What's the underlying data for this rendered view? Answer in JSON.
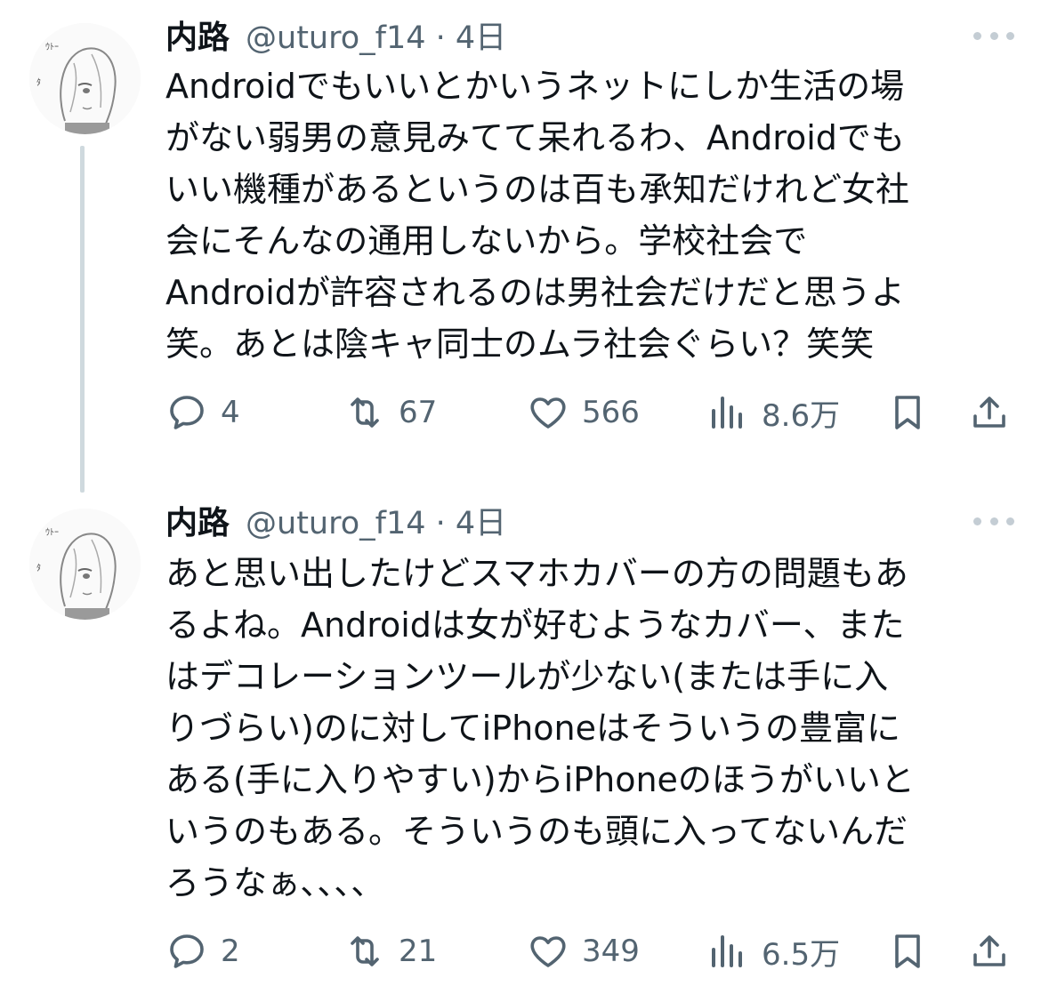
{
  "tweets": [
    {
      "name": "内路",
      "handle": "@uturo_f14 · 4日",
      "lines": [
        "Androidでもいいとかいうネットにしか生活の場",
        "がない弱男の意見みてて呆れるわ、Androidでも",
        "いい機種があるというのは百も承知だけれど女社",
        "会にそんなの通用しないから。学校社会で",
        "Androidが許容されるのは男社会だけだと思うよ",
        "笑。あとは陰キャ同士のムラ社会ぐらい？笑笑"
      ],
      "replies": "4",
      "retweets": "67",
      "likes": "566",
      "views": "8.6万"
    },
    {
      "name": "内路",
      "handle": "@uturo_f14 · 4日",
      "lines": [
        "あと思い出したけどスマホカバーの方の問題もあ",
        "るよね。Androidは女が好むようなカバー、また",
        "はデコレーションツールが少ない(または手に入",
        "りづらい)のに対してiPhoneはそういうの豊富に",
        "ある(手に入りやすい)からiPhoneのほうがいいと",
        "いうのもある。そういうのも頭に入ってないんだ",
        "ろうなぁ、、、、"
      ],
      "replies": "2",
      "retweets": "21",
      "likes": "349",
      "views": "6.5万"
    }
  ],
  "icons": {
    "avatar": "avatar-icon",
    "more": "more-icon",
    "reply": "reply-icon",
    "retweet": "retweet-icon",
    "like": "heart-icon",
    "views": "views-icon",
    "bookmark": "bookmark-icon",
    "share": "share-icon"
  },
  "colors": {
    "text": "#0f1419",
    "secondary": "#536471",
    "thread_line": "#cfd9de"
  }
}
